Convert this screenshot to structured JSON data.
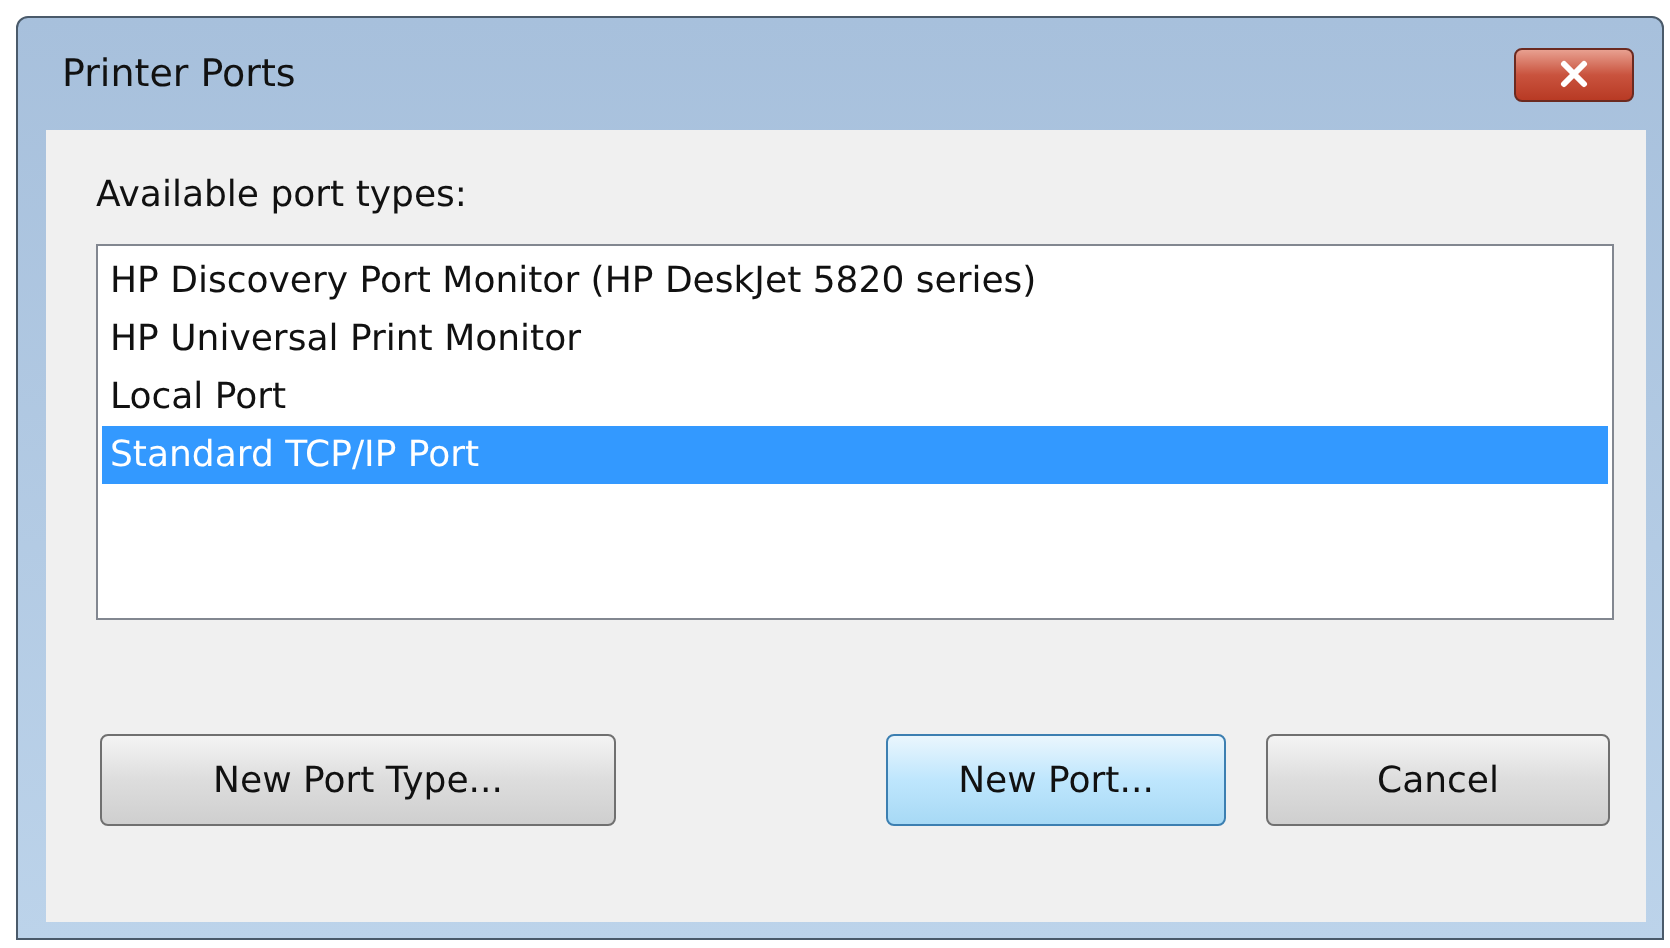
{
  "window": {
    "title": "Printer Ports"
  },
  "list": {
    "label": "Available port types:",
    "items": [
      {
        "text": "HP Discovery Port Monitor (HP DeskJet 5820 series)",
        "selected": false
      },
      {
        "text": "HP Universal Print Monitor",
        "selected": false
      },
      {
        "text": "Local Port",
        "selected": false
      },
      {
        "text": "Standard TCP/IP Port",
        "selected": true
      }
    ]
  },
  "buttons": [
    {
      "label": "New Port Type...",
      "default": false
    },
    {
      "label": "New Port...",
      "default": true
    },
    {
      "label": "Cancel",
      "default": false
    }
  ]
}
